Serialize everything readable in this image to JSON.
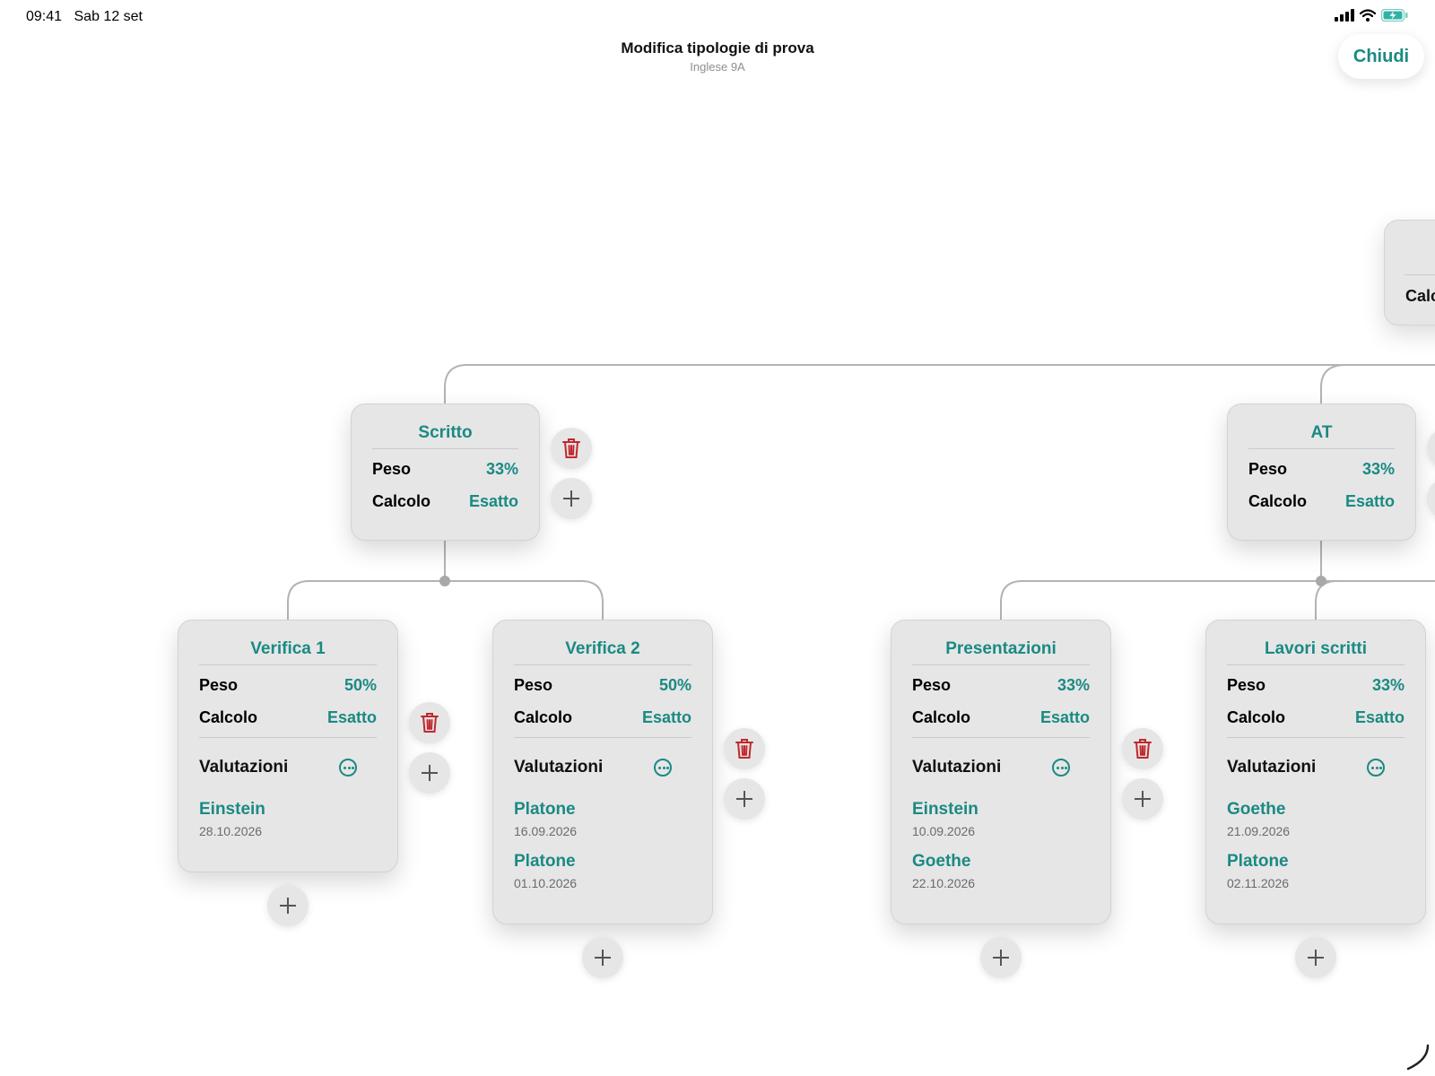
{
  "status": {
    "time": "09:41",
    "date": "Sab 12 set",
    "icons": [
      "cellular-signal-icon",
      "wifi-icon",
      "battery-charging-icon"
    ]
  },
  "nav": {
    "title": "Modifica tipologie di prova",
    "subtitle": "Inglese 9A",
    "close_label": "Chiudi"
  },
  "labels": {
    "weight": "Peso",
    "calc": "Calcolo",
    "grades": "Valutazioni"
  },
  "root_partial": {
    "calc_label": "Calc"
  },
  "groups": [
    {
      "title": "Scritto",
      "weight": "33%",
      "calc": "Esatto"
    },
    {
      "title": "AT",
      "weight": "33%",
      "calc": "Esatto"
    }
  ],
  "tests": [
    {
      "title": "Verifica 1",
      "weight": "50%",
      "calc": "Esatto",
      "grades": [
        {
          "name": "Einstein",
          "date": "28.10.2026"
        }
      ]
    },
    {
      "title": "Verifica 2",
      "weight": "50%",
      "calc": "Esatto",
      "grades": [
        {
          "name": "Platone",
          "date": "16.09.2026"
        },
        {
          "name": "Platone",
          "date": "01.10.2026"
        }
      ]
    },
    {
      "title": "Presentazioni",
      "weight": "33%",
      "calc": "Esatto",
      "grades": [
        {
          "name": "Einstein",
          "date": "10.09.2026"
        },
        {
          "name": "Goethe",
          "date": "22.10.2026"
        }
      ]
    },
    {
      "title": "Lavori scritti",
      "weight": "33%",
      "calc": "Esatto",
      "grades": [
        {
          "name": "Goethe",
          "date": "21.09.2026"
        },
        {
          "name": "Platone",
          "date": "02.11.2026"
        }
      ]
    }
  ],
  "colors": {
    "accent": "#1a8a82",
    "delete": "#c0282d",
    "card_bg": "#e6e6e7",
    "connector": "#b3b3b3"
  }
}
